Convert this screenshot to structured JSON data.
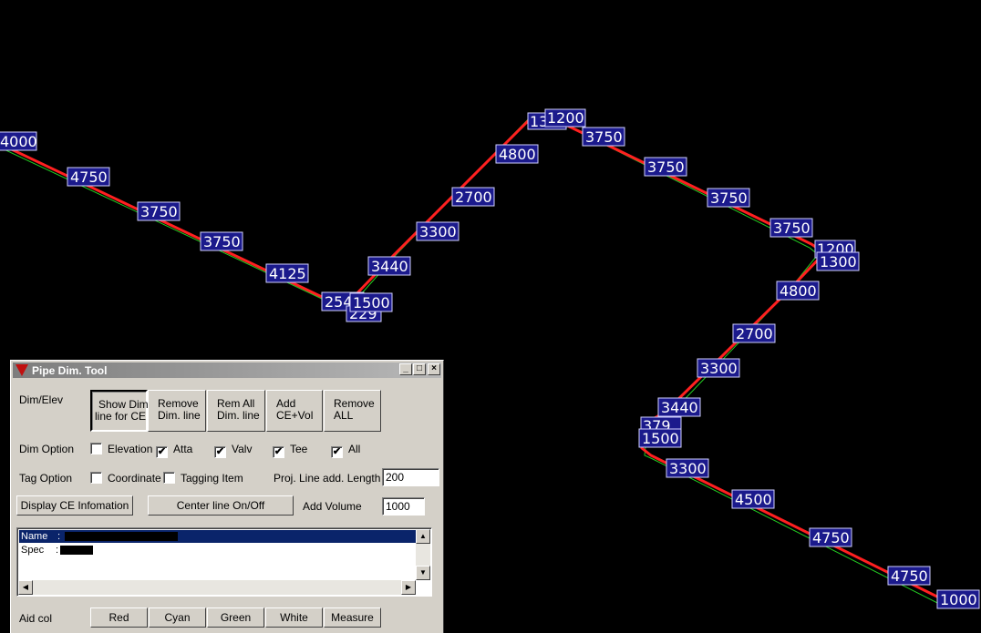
{
  "canvas": {
    "pipe_color": "#ff2020",
    "centerline_color": "#22cc22",
    "label_box_color": "#1b1a8c",
    "labels": [
      "4000",
      "4750",
      "3750",
      "3750",
      "4125",
      "2541",
      "1500",
      "229",
      "3440",
      "3300",
      "2700",
      "4800",
      "1300",
      "1200",
      "3750",
      "3750",
      "3750",
      "3750",
      "1200",
      "1300",
      "4800",
      "2700",
      "3300",
      "3440",
      "379",
      "1500",
      "3300",
      "4500",
      "4750",
      "4750",
      "1000"
    ]
  },
  "dialog": {
    "title": "Pipe Dim. Tool",
    "title_buttons": {
      "minimize": "_",
      "maximize": "□",
      "close": "×"
    },
    "dim_elev": {
      "label": "Dim/Elev",
      "buttons": [
        {
          "line1": "Show Dim.",
          "line2": "line for CE"
        },
        {
          "line1": "Remove",
          "line2": "Dim. line"
        },
        {
          "line1": "Rem All",
          "line2": "Dim. line"
        },
        {
          "line1": "Add",
          "line2": "CE+Vol"
        },
        {
          "line1": "Remove",
          "line2": "ALL"
        }
      ]
    },
    "dim_option": {
      "label": "Dim Option",
      "checkboxes": [
        {
          "label": "Elevation",
          "checked": false
        },
        {
          "label": "Atta",
          "checked": true
        },
        {
          "label": "Valv",
          "checked": true
        },
        {
          "label": "Tee",
          "checked": true
        },
        {
          "label": "All",
          "checked": true
        }
      ]
    },
    "tag_option": {
      "label": "Tag Option",
      "checkboxes": [
        {
          "label": "Coordinate",
          "checked": false
        },
        {
          "label": "Tagging Item",
          "checked": false
        }
      ],
      "proj_label": "Proj. Line add. Length",
      "proj_value": "200"
    },
    "display_ce_button": "Display CE Infomation",
    "centerline_button": "Center line On/Off",
    "add_volume_label": "Add Volume",
    "add_volume_value": "1000",
    "list": {
      "rows": [
        {
          "key": "Name",
          "sep": ":",
          "selected": true
        },
        {
          "key": "Spec",
          "sep": ":",
          "selected": false
        }
      ]
    },
    "aid_col": {
      "label": "Aid col",
      "buttons": [
        "Red",
        "Cyan",
        "Green",
        "White",
        "Measure"
      ]
    }
  }
}
